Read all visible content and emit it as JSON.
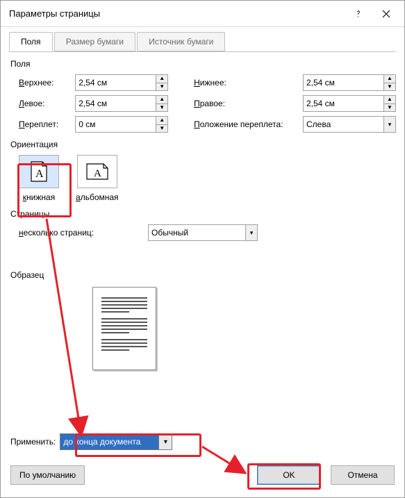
{
  "titlebar": {
    "title": "Параметры страницы"
  },
  "tabs": {
    "fields": "Поля",
    "paper_size": "Размер бумаги",
    "paper_source": "Источник бумаги"
  },
  "sections": {
    "margins": "Поля",
    "orientation": "Ориентация",
    "pages": "Страницы",
    "preview": "Образец"
  },
  "margins": {
    "top_label": "Верхнее:",
    "top_value": "2,54 см",
    "bottom_label": "Нижнее:",
    "bottom_value": "2,54 см",
    "left_label": "Левое:",
    "left_value": "2,54 см",
    "right_label": "Правое:",
    "right_value": "2,54 см",
    "gutter_label": "Переплет:",
    "gutter_value": "0 см",
    "gutter_pos_label": "Положение переплета:",
    "gutter_pos_value": "Слева"
  },
  "orientation": {
    "portrait_pre": "к",
    "portrait_rest": "нижная",
    "landscape_pre": "а",
    "landscape_rest": "льбомная"
  },
  "pages": {
    "multiple_label": "несколько страниц:",
    "multiple_value": "Обычный"
  },
  "apply": {
    "label": "Применить:",
    "value": "до конца документа"
  },
  "buttons": {
    "default": "По умолчанию",
    "ok": "OK",
    "cancel": "Отмена"
  },
  "colors": {
    "highlight": "#e4212a",
    "selection": "#2f6fc2"
  },
  "icons": {
    "help": "help-icon",
    "close": "close-icon",
    "spin_up": "▲",
    "spin_down": "▼",
    "dropdown": "▾"
  }
}
